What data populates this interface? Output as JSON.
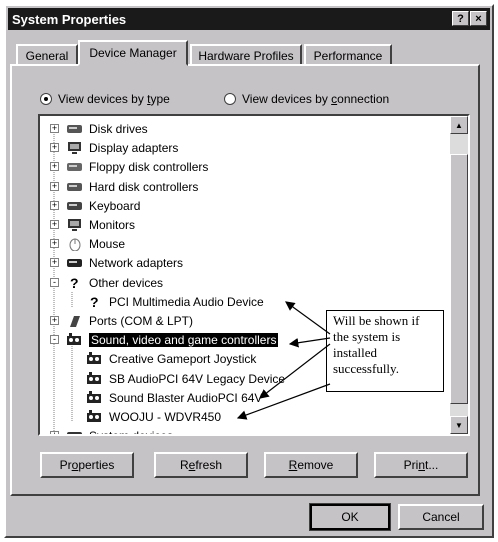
{
  "window": {
    "title": "System Properties",
    "help_icon": "?",
    "close_icon": "×"
  },
  "tabs": [
    {
      "label": "General"
    },
    {
      "label": "Device Manager",
      "active": true
    },
    {
      "label": "Hardware Profiles"
    },
    {
      "label": "Performance"
    }
  ],
  "view_options": {
    "by_type": {
      "prefix": "View devices by ",
      "key": "t",
      "suffix": "ype",
      "selected": true
    },
    "by_connection": {
      "prefix": "View devices by ",
      "key": "c",
      "suffix": "onnection",
      "selected": false
    }
  },
  "tree": {
    "items": [
      {
        "label": "Disk drives",
        "icon": "disk-drive-icon",
        "expander": "+"
      },
      {
        "label": "Display adapters",
        "icon": "display-adapter-icon",
        "expander": "+"
      },
      {
        "label": "Floppy disk controllers",
        "icon": "floppy-controller-icon",
        "expander": "+"
      },
      {
        "label": "Hard disk controllers",
        "icon": "hard-disk-controller-icon",
        "expander": "+"
      },
      {
        "label": "Keyboard",
        "icon": "keyboard-icon",
        "expander": "+"
      },
      {
        "label": "Monitors",
        "icon": "monitor-icon",
        "expander": "+"
      },
      {
        "label": "Mouse",
        "icon": "mouse-icon",
        "expander": "+"
      },
      {
        "label": "Network adapters",
        "icon": "network-adapter-icon",
        "expander": "+"
      },
      {
        "label": "Other devices",
        "icon": "question-mark-icon",
        "expander": "-"
      },
      {
        "label": "PCI Multimedia Audio Device",
        "icon": "unknown-device-icon",
        "child": true
      },
      {
        "label": "Ports (COM & LPT)",
        "icon": "port-icon",
        "expander": "+"
      },
      {
        "label": "Sound, video and game controllers",
        "icon": "sound-controller-icon",
        "expander": "-",
        "selected": true
      },
      {
        "label": "Creative Gameport Joystick",
        "icon": "sound-device-icon",
        "child": true
      },
      {
        "label": "SB AudioPCI 64V Legacy Device",
        "icon": "sound-device-icon",
        "child": true
      },
      {
        "label": "Sound Blaster AudioPCI 64V",
        "icon": "sound-device-icon",
        "child": true
      },
      {
        "label": "WOOJU - WDVR450",
        "icon": "sound-device-icon",
        "child": true
      },
      {
        "label": "System devices",
        "icon": "system-device-icon",
        "expander": "+"
      }
    ]
  },
  "callout": {
    "text": "Will be shown if the system is installed successfully."
  },
  "buttons": {
    "properties": {
      "prefix": "Pr",
      "key": "o",
      "suffix": "perties"
    },
    "refresh": {
      "prefix": "R",
      "key": "e",
      "suffix": "fresh"
    },
    "remove": {
      "prefix": "",
      "key": "R",
      "suffix": "emove"
    },
    "print": {
      "prefix": "Pri",
      "key": "n",
      "suffix": "t..."
    },
    "ok": "OK",
    "cancel": "Cancel"
  }
}
